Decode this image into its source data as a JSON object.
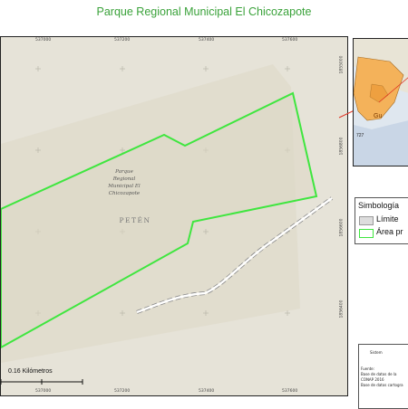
{
  "title": "Parque Regional Municipal El Chicozapote",
  "map": {
    "region_label": "PETÉN",
    "park_label_lines": [
      "Parque",
      "Regional",
      "Municipal El",
      "Chicozapote"
    ],
    "grid_top": [
      "537000",
      "537200",
      "537400",
      "537600"
    ],
    "grid_bottom": [
      "537000",
      "537200",
      "537400",
      "537600"
    ],
    "grid_right": [
      "1855000",
      "1856800",
      "1856600",
      "1856400"
    ],
    "colors": {
      "park_outline": "#3fe63f",
      "background": "#e6e3d8",
      "road": "#ffffff"
    }
  },
  "scale_bar": {
    "label": "0.16 Kilómetros"
  },
  "inset": {
    "label_1": "Gu",
    "label_2": "727"
  },
  "legend": {
    "title": "Simbología",
    "items": [
      {
        "label": "Límite",
        "color": "#dddddd"
      },
      {
        "label": "Área pr",
        "color": "#3fe63f"
      }
    ]
  },
  "info": {
    "header": "Sistem",
    "lines": [
      "Fuente:",
      "Base de datos de la",
      "CONAP 2016",
      "Base de datos cartogra"
    ]
  }
}
